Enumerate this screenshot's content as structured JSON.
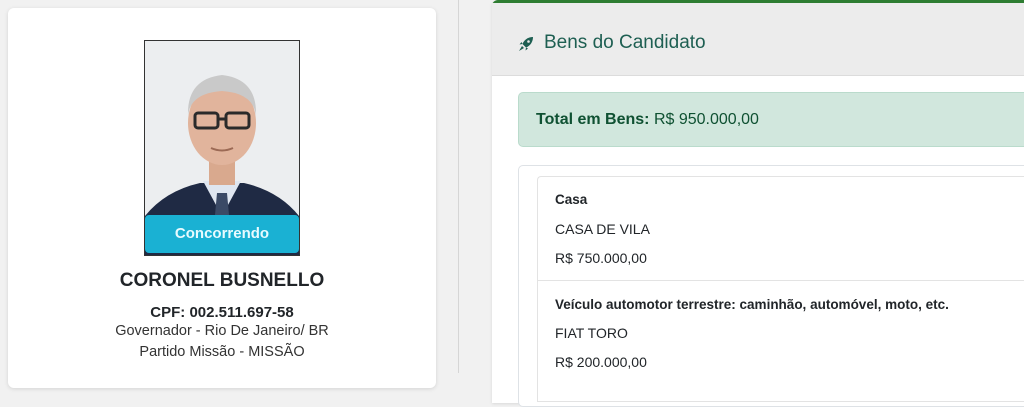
{
  "candidate": {
    "status_badge": "Concorrendo",
    "name": "CORONEL BUSNELLO",
    "cpf": "CPF: 002.511.697-58",
    "office": "Governador - Rio De Janeiro/ BR",
    "party": "Partido Missão - MISSÃO"
  },
  "assets_card": {
    "icon": "rocket-icon",
    "title": "Bens do Candidato",
    "total_label": "Total em Bens:",
    "total_value": "R$ 950.000,00",
    "items": [
      {
        "type": "Casa",
        "description": "CASA DE VILA",
        "value": "R$ 750.000,00"
      },
      {
        "type": "Veículo automotor terrestre: caminhão, automóvel, moto, etc.",
        "description": "FIAT TORO",
        "value": "R$ 200.000,00"
      }
    ]
  },
  "colors": {
    "badge": "#1ab1d3",
    "title": "#1e5f52",
    "alert_bg": "#d1e7dd",
    "alert_text": "#0f5132",
    "card_top_border": "#2e7d32"
  }
}
